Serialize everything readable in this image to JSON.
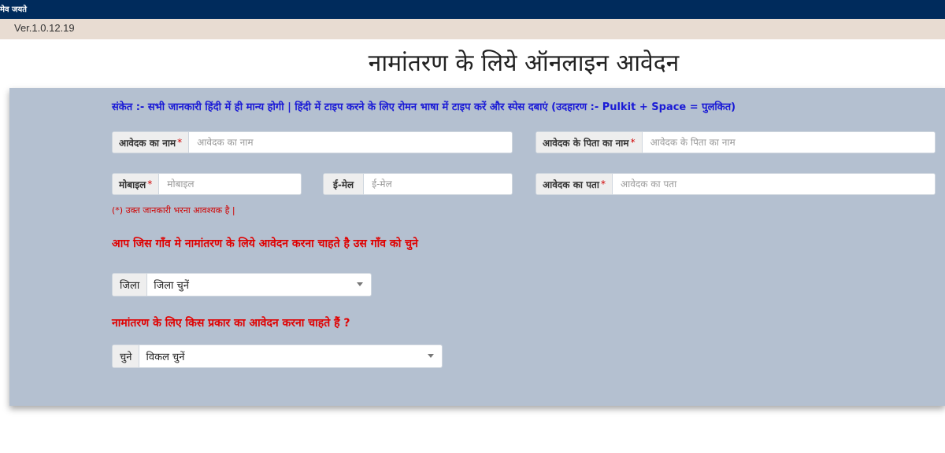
{
  "header": {
    "motto": "मेव जयते",
    "version": "Ver.1.0.12.19"
  },
  "page": {
    "title": "नामांतरण के लिये ऑनलाइन आवेदन"
  },
  "form": {
    "hint": "संकेत :- सभी जानकारी हिंदी में ही मान्य होगी | हिंदी में टाइप करने के लिए रोमन भाषा में टाइप करें और स्पेस दबाएं (उदहारण :- Pulkit + Space = पुलकित)",
    "required_mark": "*",
    "applicant_name": {
      "label": "आवेदक का नाम",
      "placeholder": "आवेदक का नाम",
      "value": ""
    },
    "father_name": {
      "label": "आवेदक के पिता का नाम",
      "placeholder": "आवेदक के पिता का नाम",
      "value": ""
    },
    "mobile": {
      "label": "मोबाइल",
      "placeholder": "मोबाइल",
      "value": ""
    },
    "email": {
      "label": "ई-मेल",
      "placeholder": "ई-मेल",
      "value": ""
    },
    "address": {
      "label": "आवेदक का पता",
      "placeholder": "आवेदक का पता",
      "value": ""
    },
    "required_note": "(*) उक्त जानकारी भरना आवश्यक है |",
    "village_question": "आप जिस गाँव मे नामांतरण के लिये आवेदन करना चाहते है उस गाँव को चुने",
    "district": {
      "label": "जिला",
      "selected": "जिला चुनें"
    },
    "type_question": "नामांतरण के लिए किस प्रकार का आवेदन करना चाहते हैं ?",
    "option": {
      "label": "चुने",
      "selected": "विकल चुनें"
    }
  },
  "colors": {
    "header_bg": "#002b5c",
    "version_bg": "#e8dcd2",
    "panel_bg": "#b4c0d0",
    "hint": "#1a1ad6",
    "question": "#e00000",
    "required": "#d00000"
  },
  "icons": {
    "select_caret": "caret-down-icon"
  }
}
